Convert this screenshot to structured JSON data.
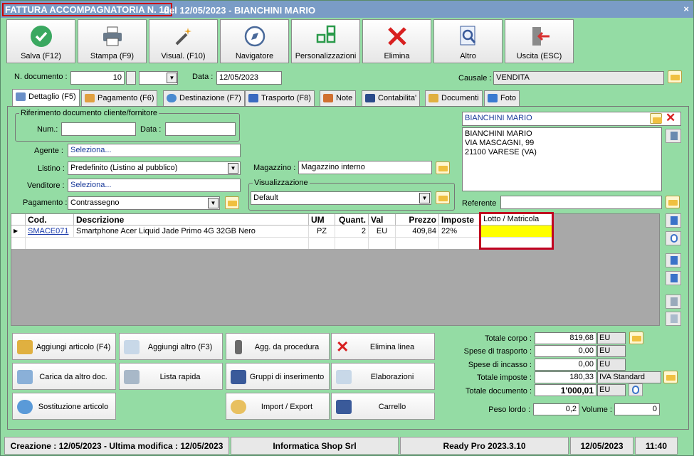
{
  "window": {
    "title": "FATTURA ACCOMPAGNATORIA N. 10",
    "title_rest": "del 12/05/2023 - BIANCHINI MARIO",
    "close": "×"
  },
  "toolbar": [
    {
      "label": "Salva (F12)",
      "icon": "check-icon"
    },
    {
      "label": "Stampa (F9)",
      "icon": "printer-icon"
    },
    {
      "label": "Visual. (F10)",
      "icon": "wand-icon"
    },
    {
      "label": "Navigatore",
      "icon": "compass-icon"
    },
    {
      "label": "Personalizzazioni",
      "icon": "grid-icon"
    },
    {
      "label": "Elimina",
      "icon": "delete-icon"
    },
    {
      "label": "Altro",
      "icon": "search-doc-icon"
    },
    {
      "label": "Uscita (ESC)",
      "icon": "exit-icon"
    }
  ],
  "header": {
    "ndoc_label": "N. documento :",
    "ndoc_value": "10",
    "data_label": "Data :",
    "data_value": "12/05/2023",
    "causale_label": "Causale :",
    "causale_value": "VENDITA"
  },
  "tabs": [
    {
      "label": "Dettaglio (F5)"
    },
    {
      "label": "Pagamento (F6)"
    },
    {
      "label": "Destinazione (F7)"
    },
    {
      "label": "Trasporto (F8)"
    },
    {
      "label": "Note"
    },
    {
      "label": "Contabilita'"
    },
    {
      "label": "Documenti"
    },
    {
      "label": "Foto"
    }
  ],
  "rif": {
    "group_label": "Riferimento documento cliente/fornitore",
    "num_label": "Num.:",
    "num_value": "",
    "data_label": "Data :",
    "data_value": ""
  },
  "fields": {
    "agente_label": "Agente :",
    "agente_value": "Seleziona...",
    "listino_label": "Listino :",
    "listino_value": "Predefinito (Listino al pubblico)",
    "venditore_label": "Venditore :",
    "venditore_value": "Seleziona...",
    "pagamento_label": "Pagamento :",
    "pagamento_value": "Contrassegno",
    "magazzino_label": "Magazzino :",
    "magazzino_value": "Magazzino interno",
    "visual_label": "Visualizzazione",
    "visual_value": "Default"
  },
  "customer": {
    "name": "BIANCHINI MARIO",
    "address": [
      "BIANCHINI MARIO",
      "VIA MASCAGNI, 99",
      "21100 VARESE (VA)"
    ],
    "referente_label": "Referente",
    "referente_value": ""
  },
  "grid": {
    "headers": [
      "Cod.",
      "Descrizione",
      "UM",
      "Quant.",
      "Val",
      "Prezzo",
      "Imposte",
      "Lotto / Matricola"
    ],
    "rows": [
      {
        "cod": "SMACE071",
        "desc": "Smartphone Acer Liquid Jade Primo 4G 32GB Nero",
        "um": "PZ",
        "qty": "2",
        "val": "EU",
        "prezzo": "409,84",
        "imposte": "22%",
        "lotto": ""
      }
    ],
    "marker": "▶"
  },
  "actions": [
    {
      "label": "Aggiungi articolo (F4)"
    },
    {
      "label": "Aggiungi altro (F3)"
    },
    {
      "label": "Agg. da procedura"
    },
    {
      "label": "Elimina linea"
    },
    {
      "label": "Carica da altro doc."
    },
    {
      "label": "Lista rapida"
    },
    {
      "label": "Gruppi di inserimento"
    },
    {
      "label": "Elaborazioni"
    },
    {
      "label": "Sostituzione articolo"
    },
    {
      "label": "Import / Export"
    },
    {
      "label": "Carrello"
    }
  ],
  "totals": {
    "corpo_label": "Totale corpo :",
    "corpo_value": "819,68",
    "corpo_cur": "EU",
    "trasporto_label": "Spese di trasporto :",
    "trasporto_value": "0,00",
    "trasporto_cur": "EU",
    "incasso_label": "Spese di incasso :",
    "incasso_value": "0,00",
    "incasso_cur": "EU",
    "imposte_label": "Totale imposte :",
    "imposte_value": "180,33",
    "imposte_cur": "IVA Standard",
    "documento_label": "Totale documento :",
    "documento_value": "1'000,01",
    "documento_cur": "EU",
    "peso_label": "Peso lordo :",
    "peso_value": "0,2",
    "volume_label": "Volume :",
    "volume_value": "0"
  },
  "status": {
    "creazione": "Creazione : 12/05/2023 - Ultima modifica : 12/05/2023",
    "company": "Informatica Shop Srl",
    "version": "Ready Pro 2023.3.10",
    "date": "12/05/2023",
    "time": "11:40"
  }
}
